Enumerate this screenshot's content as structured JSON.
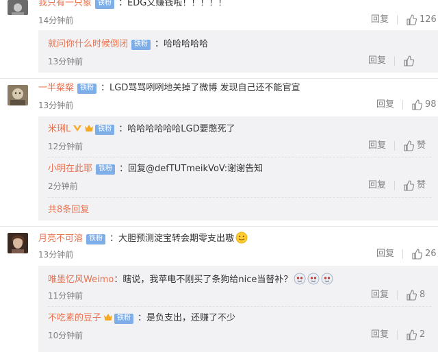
{
  "comments": [
    {
      "user": "我只有一只象",
      "badge": "铁粉",
      "text": "EDG又赚钱啦！！！！！",
      "time": "14分钟前",
      "reply_label": "回复",
      "likes": "126",
      "replies": [
        {
          "user": "就问你什么时候倒闭",
          "badge": "铁粉",
          "text": "哈哈哈哈哈",
          "time": "13分钟前",
          "reply_label": "回复",
          "likes": ""
        }
      ]
    },
    {
      "user": "一半粲粲",
      "badge": "铁粉",
      "text": "LGD骂骂咧咧地关掉了微博 发现自己还不能官宣",
      "time": "13分钟前",
      "reply_label": "回复",
      "likes": "98",
      "replies": [
        {
          "user": "米琍L",
          "badge": "铁粉",
          "text": "哈哈哈哈哈哈LGD要憋死了",
          "time": "12分钟前",
          "reply_label": "回复",
          "likes": "赞"
        },
        {
          "user": "小明在此耶",
          "badge": "铁粉",
          "text": "回复@defTUTmeikVoV:谢谢告知",
          "time": "2分钟前",
          "reply_label": "回复",
          "likes": "赞"
        }
      ],
      "more_replies": "共8条回复"
    },
    {
      "user": "月亮不可溶",
      "badge": "铁粉",
      "text": "大胆预测淀宝转会期零支出嗷",
      "time": "13分钟前",
      "reply_label": "回复",
      "likes": "26",
      "replies": [
        {
          "user": "唯墨忆风Weimo",
          "badge": "",
          "text": "瞎说，我苹电不刚买了条狗给nice当替补？",
          "time": "11分钟前",
          "reply_label": "回复",
          "likes": "8"
        },
        {
          "user": "不吃素的豆子",
          "badge": "铁粉",
          "text": "是负支出，还赚了不少",
          "time": "10分钟前",
          "reply_label": "回复",
          "likes": "2"
        }
      ]
    }
  ],
  "colors": {
    "username": "#eb7350",
    "badge": "#7eaee8",
    "muted": "#808080",
    "reply_bg": "#f2f2f5"
  },
  "icons": {
    "like": "thumbs-up-icon",
    "vip": "crown-icon",
    "emoji": "smile-emoji-icon"
  }
}
